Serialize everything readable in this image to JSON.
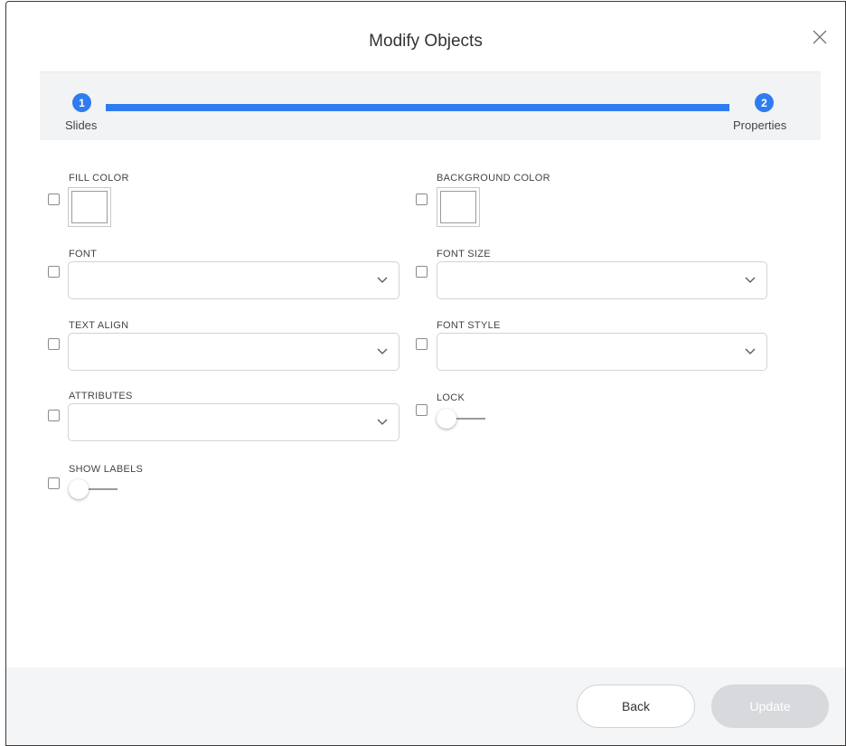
{
  "dialog": {
    "title": "Modify Objects",
    "close_icon": "close-icon"
  },
  "stepper": {
    "steps": [
      {
        "number": "1",
        "label": "Slides"
      },
      {
        "number": "2",
        "label": "Properties"
      }
    ],
    "active_color": "#2f7cf0"
  },
  "fields": {
    "fill_color": {
      "label": "FILL COLOR",
      "checked": false,
      "value": "#ffffff"
    },
    "background_color": {
      "label": "BACKGROUND COLOR",
      "checked": false,
      "value": "#ffffff"
    },
    "font": {
      "label": "FONT",
      "checked": false,
      "value": ""
    },
    "font_size": {
      "label": "FONT SIZE",
      "checked": false,
      "value": ""
    },
    "text_align": {
      "label": "TEXT ALIGN",
      "checked": false,
      "value": ""
    },
    "font_style": {
      "label": "FONT STYLE",
      "checked": false,
      "value": ""
    },
    "attributes": {
      "label": "ATTRIBUTES",
      "checked": false,
      "value": ""
    },
    "lock": {
      "label": "LOCK",
      "checked": false,
      "on": false
    },
    "show_labels": {
      "label": "SHOW LABELS",
      "checked": false,
      "on": false
    }
  },
  "footer": {
    "back_label": "Back",
    "update_label": "Update",
    "update_disabled": true
  }
}
